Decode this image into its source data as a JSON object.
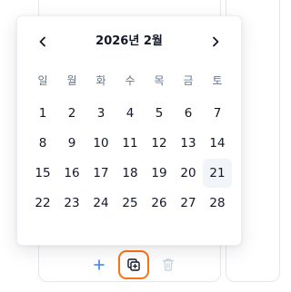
{
  "calendar": {
    "title": "2026년 2월",
    "prev_label": "‹",
    "next_label": "›",
    "weekdays": [
      "일",
      "월",
      "화",
      "수",
      "목",
      "금",
      "토"
    ],
    "weeks": [
      [
        "1",
        "2",
        "3",
        "4",
        "5",
        "6",
        "7"
      ],
      [
        "8",
        "9",
        "10",
        "11",
        "12",
        "13",
        "14"
      ],
      [
        "15",
        "16",
        "17",
        "18",
        "19",
        "20",
        "21"
      ],
      [
        "22",
        "23",
        "24",
        "25",
        "26",
        "27",
        "28"
      ]
    ],
    "highlighted_day": "21"
  },
  "toolbar": {
    "icons": [
      "plus-icon",
      "copy-icon",
      "trash-icon"
    ]
  },
  "colors": {
    "accent_blue": "#3b82f6",
    "focus_orange": "#f97316",
    "weekday_gray": "#64748b",
    "highlight_bg": "#f1f4f8"
  }
}
